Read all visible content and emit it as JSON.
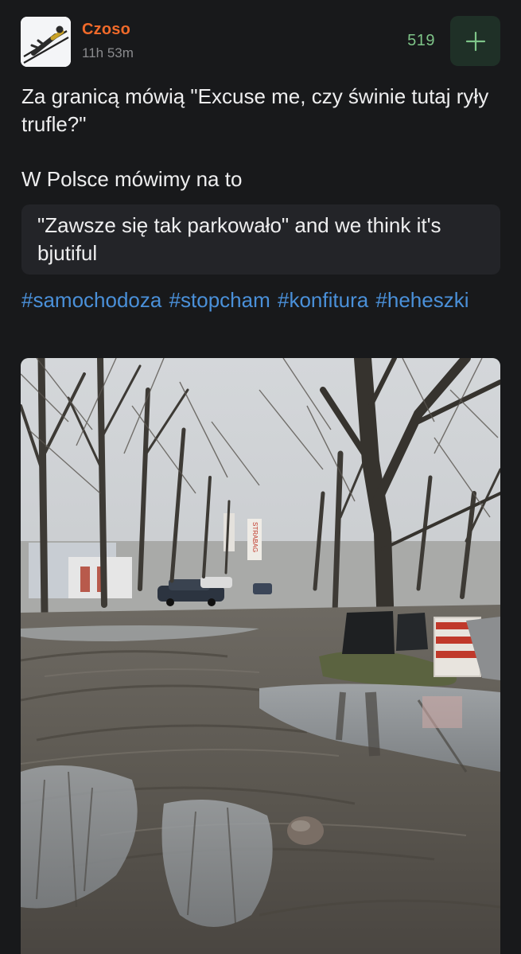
{
  "post": {
    "author": "Czoso",
    "time": "11h 53m",
    "score": "519",
    "plus_symbol": "+",
    "text_line1": "Za granicą mówią \"Excuse me, czy świnie tutaj ryły trufle?\"",
    "text_line2": "W Polsce mówimy na to",
    "quote": "\"Zawsze się tak parkowało\" and we think it's bjutiful",
    "tags": [
      "#samochodoza",
      "#stopcham",
      "#konfitura",
      "#heheszki"
    ],
    "photo_sign_text": "STRABAG"
  },
  "colors": {
    "background": "#18191b",
    "author": "#f06a2a",
    "score": "#7ec488",
    "tag": "#4a90d9",
    "quote_bg": "#232428",
    "plus_bg": "#1f3027"
  },
  "icons": {
    "avatar": "ski-jumper-avatar",
    "plus": "plus-icon"
  }
}
